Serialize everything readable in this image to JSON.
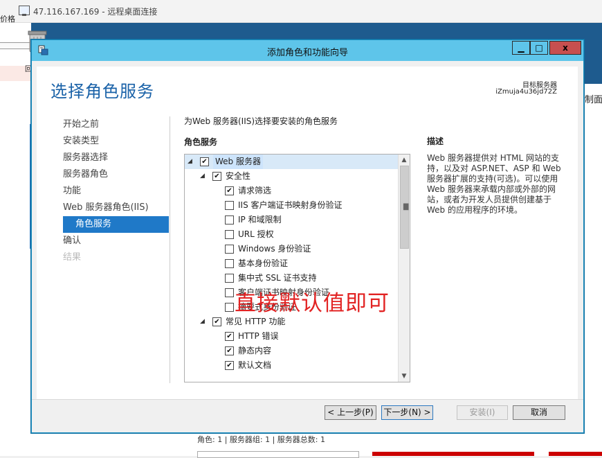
{
  "rdp": {
    "title": "47.116.167.169 - 远程桌面连接"
  },
  "background": {
    "left_text_top": "价格",
    "left_text_mid": "回",
    "right_text": "制面",
    "status_text": "角色: 1 | 服务器组: 1 | 服务器总数: 1"
  },
  "dialog": {
    "title": "添加角色和功能向导",
    "controls": {
      "minimize": "▁",
      "maximize": "□",
      "close": "x"
    },
    "page_title": "选择角色服务",
    "target_label": "目标服务器",
    "target_value": "iZmuja4u36jd72Z",
    "nav": [
      {
        "label": "开始之前",
        "state": "normal"
      },
      {
        "label": "安装类型",
        "state": "normal"
      },
      {
        "label": "服务器选择",
        "state": "normal"
      },
      {
        "label": "服务器角色",
        "state": "normal"
      },
      {
        "label": "功能",
        "state": "normal"
      },
      {
        "label": "Web 服务器角色(IIS)",
        "state": "normal"
      },
      {
        "label": "角色服务",
        "state": "active"
      },
      {
        "label": "确认",
        "state": "normal"
      },
      {
        "label": "结果",
        "state": "disabled"
      }
    ],
    "instruction": "为Web 服务器(IIS)选择要安装的角色服务",
    "role_services_header": "角色服务",
    "tree": [
      {
        "label": "Web 服务器",
        "level": 0,
        "expander": "◢",
        "checked": true,
        "selected": true
      },
      {
        "label": "安全性",
        "level": 1,
        "expander": "◢",
        "checked": true
      },
      {
        "label": "请求筛选",
        "level": 2,
        "checked": true
      },
      {
        "label": "IIS 客户端证书映射身份验证",
        "level": 2,
        "checked": false
      },
      {
        "label": "IP 和域限制",
        "level": 2,
        "checked": false
      },
      {
        "label": "URL 授权",
        "level": 2,
        "checked": false
      },
      {
        "label": "Windows 身份验证",
        "level": 2,
        "checked": false
      },
      {
        "label": "基本身份验证",
        "level": 2,
        "checked": false
      },
      {
        "label": "集中式 SSL 证书支持",
        "level": 2,
        "checked": false
      },
      {
        "label": "客户端证书映射身份验证",
        "level": 2,
        "checked": false
      },
      {
        "label": "摘要式身份验证",
        "level": 2,
        "checked": false
      },
      {
        "label": "常见 HTTP 功能",
        "level": 1,
        "expander": "◢",
        "checked": true
      },
      {
        "label": "HTTP 错误",
        "level": 2,
        "checked": true
      },
      {
        "label": "静态内容",
        "level": 2,
        "checked": true
      },
      {
        "label": "默认文档",
        "level": 2,
        "checked": true
      }
    ],
    "scroll_up": "▲",
    "scroll_down": "▼",
    "overlay_annotation": "直接默认值即可",
    "description_title": "描述",
    "description_body": "Web 服务器提供对 HTML 网站的支持，以及对 ASP.NET、ASP 和 Web 服务器扩展的支持(可选)。可以使用 Web 服务器来承载内部或外部的网站，或者为开发人员提供创建基于 Web 的应用程序的环境。",
    "buttons": {
      "prev": "< 上一步(P)",
      "next": "下一步(N) >",
      "install": "安装(I)",
      "cancel": "取消"
    }
  }
}
